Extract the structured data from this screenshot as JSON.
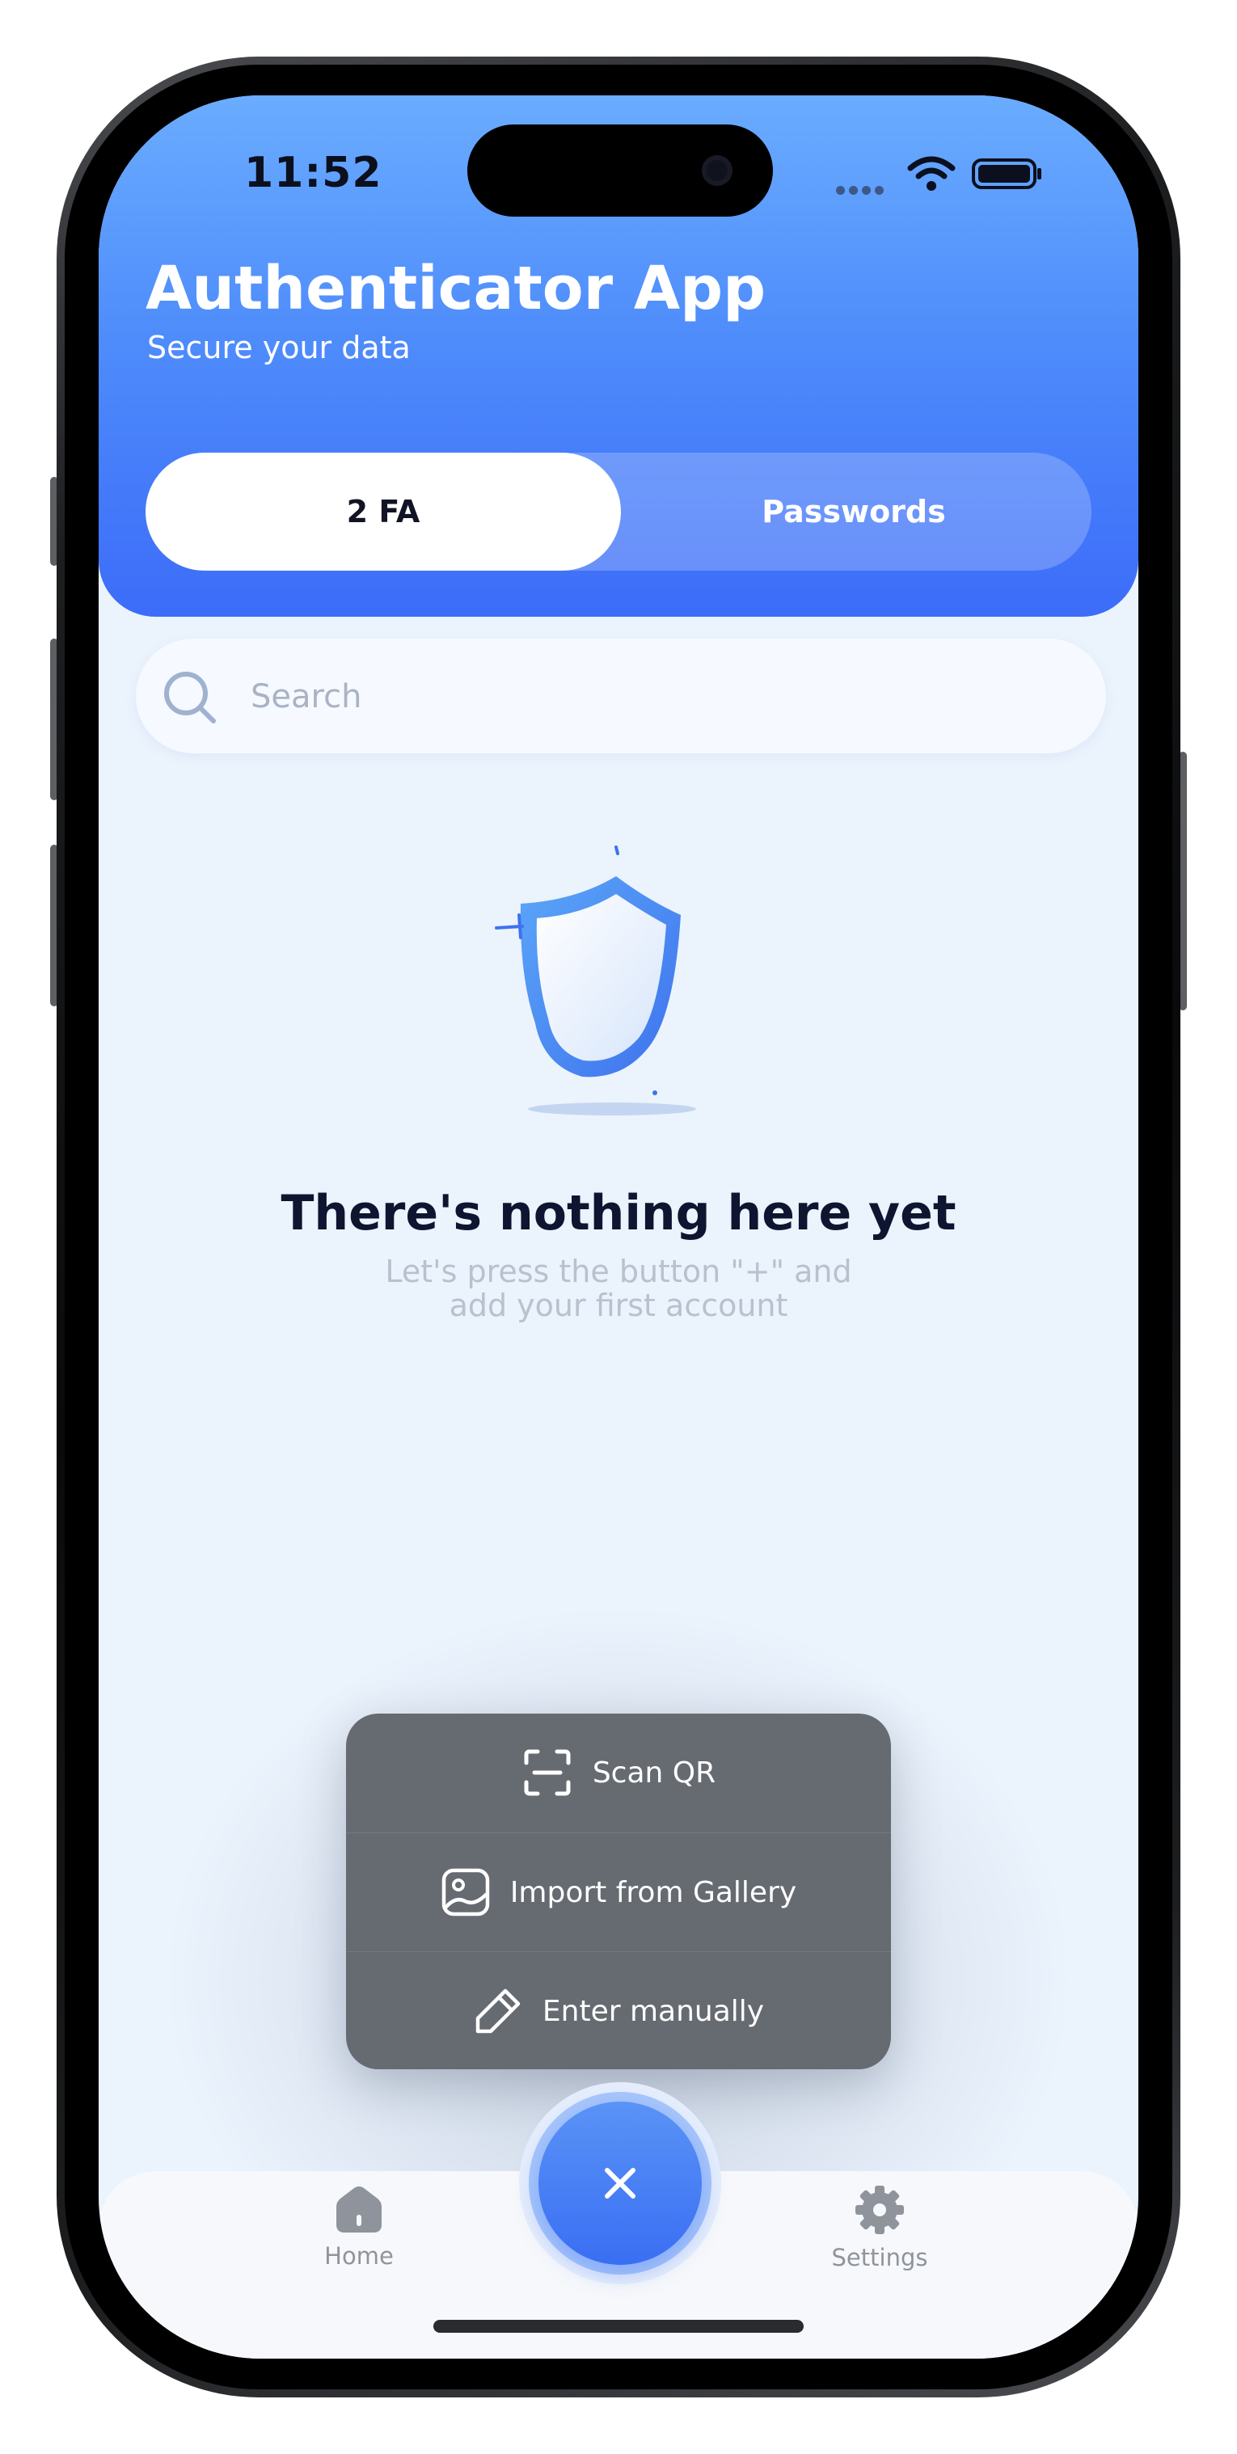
{
  "status_bar": {
    "time": "11:52"
  },
  "header": {
    "title": "Authenticator App",
    "subtitle": "Secure your data",
    "tabs": [
      {
        "label": "2 FA",
        "active": true
      },
      {
        "label": "Passwords",
        "active": false
      }
    ]
  },
  "search": {
    "placeholder": "Search"
  },
  "empty_state": {
    "title": "There's nothing here yet",
    "line1": "Let's press the button \"+\" and",
    "line2": "add your first account"
  },
  "add_menu": {
    "items": [
      {
        "label": "Scan QR",
        "icon": "scan-qr-icon"
      },
      {
        "label": "Import from Gallery",
        "icon": "gallery-icon"
      },
      {
        "label": "Enter manually",
        "icon": "pencil-icon"
      }
    ]
  },
  "tab_bar": {
    "home_label": "Home",
    "settings_label": "Settings",
    "fab_icon": "close-icon"
  },
  "colors": {
    "header_top": "#6aacff",
    "header_bottom": "#3c6cf9",
    "background": "#ebf3fd",
    "menu": "#666a71",
    "fab": "#3a6ef3"
  }
}
